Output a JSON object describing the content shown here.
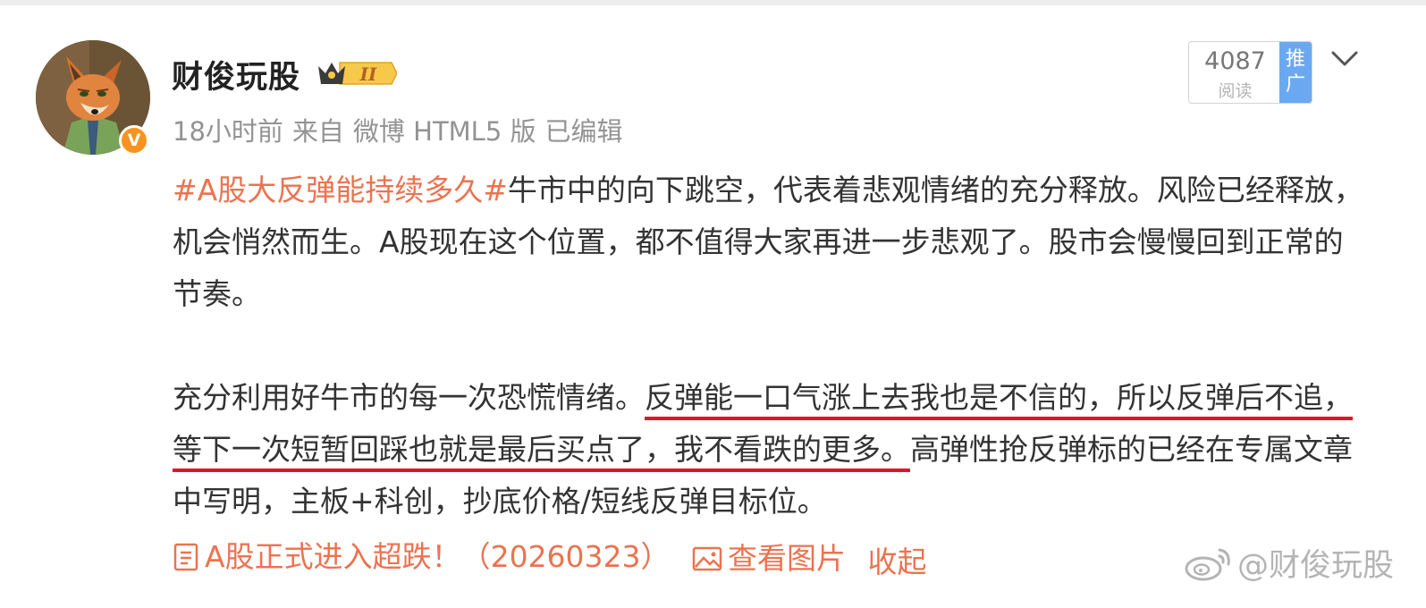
{
  "post": {
    "author": "财俊玩股",
    "verified_mark": "V",
    "vip_level": "II",
    "meta": {
      "time": "18小时前",
      "from_prefix": "来自",
      "source": "微博 HTML5 版",
      "edited": "已编辑"
    },
    "reads": {
      "count": "4087",
      "label": "阅读",
      "promote_label": "推广"
    },
    "paragraph1": {
      "topic": "#A股大反弹能持续多久#",
      "text": "牛市中的向下跳空，代表着悲观情绪的充分释放。风险已经释放，机会悄然而生。A股现在这个位置，都不值得大家再进一步悲观了。股市会慢慢回到正常的节奏。"
    },
    "paragraph2": {
      "before": "充分利用好牛市的每一次恐慌情绪。",
      "underlined": "反弹能一口气涨上去我也是不信的，所以反弹后不追，等下一次短暂回踩也就是最后买点了，我不看跌的更多。",
      "after": "高弹性抢反弹标的已经在专属文章中写明，主板+科创，抄底价格/短线反弹目标位。"
    },
    "links": {
      "article": "A股正式进入超跌！（20260323）",
      "view_images": "查看图片",
      "collapse": "收起"
    },
    "watermark": "@财俊玩股"
  },
  "colors": {
    "accent": "#eb7350",
    "underline": "#e0142b",
    "promote": "#6aa9f2",
    "verified": "#f7931e",
    "meta_text": "#939393"
  },
  "icons": [
    "avatar-fox",
    "verified-icon",
    "vip-crown-icon",
    "chevron-down-icon",
    "article-icon",
    "image-icon",
    "weibo-logo-icon"
  ]
}
